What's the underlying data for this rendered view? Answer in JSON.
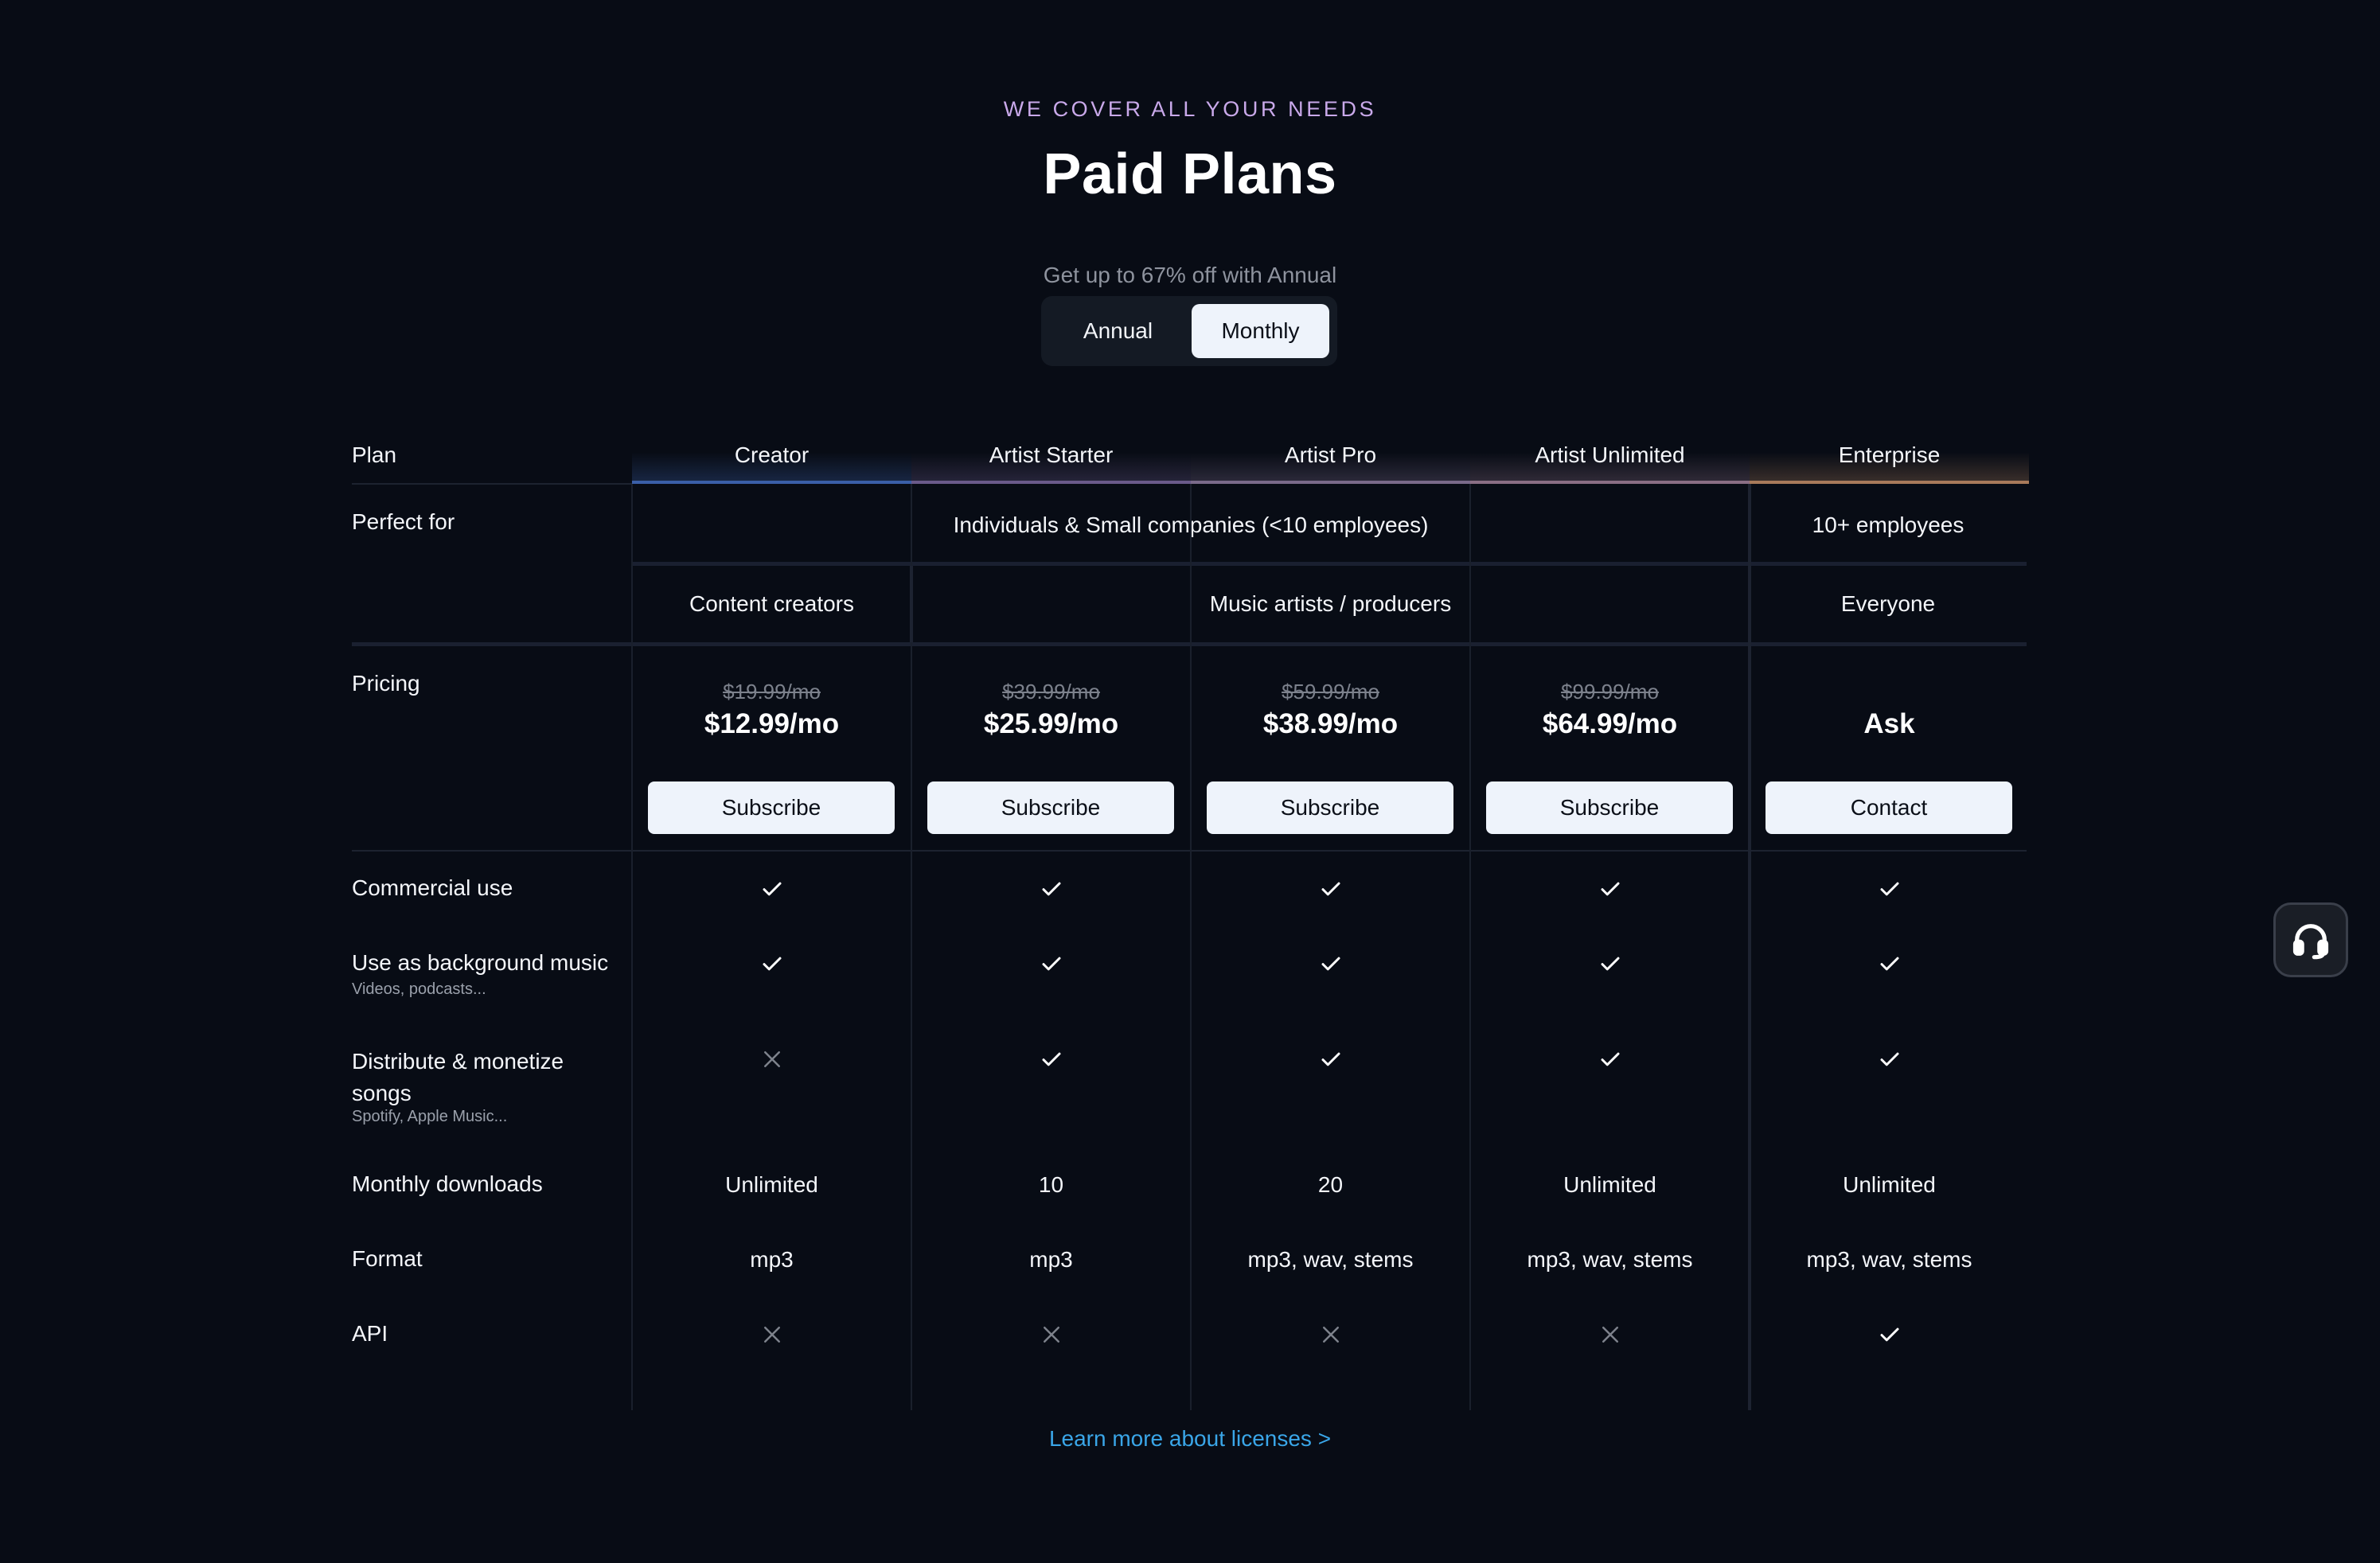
{
  "header": {
    "eyebrow": "WE COVER ALL YOUR NEEDS",
    "title": "Paid Plans",
    "discount_note": "Get up to 67% off with Annual"
  },
  "billing_toggle": {
    "options": [
      "Annual",
      "Monthly"
    ],
    "selected": "Monthly"
  },
  "table": {
    "row_labels": {
      "plan": "Plan",
      "perfect_for": "Perfect for",
      "pricing": "Pricing",
      "commercial_use": "Commercial use",
      "background_music": "Use as background music",
      "background_music_sub": "Videos, podcasts...",
      "distribute": "Distribute & monetize songs",
      "distribute_line1": "Distribute & monetize",
      "distribute_line2": "songs",
      "distribute_sub": "Spotify, Apple Music...",
      "monthly_downloads": "Monthly downloads",
      "format": "Format",
      "api": "API"
    },
    "audience_groups": {
      "row1": [
        {
          "text": "Individuals & Small companies (<10 employees)",
          "span": "Creator–Artist Unlimited"
        },
        {
          "text": "10+ employees",
          "span": "Enterprise"
        }
      ],
      "row2": [
        {
          "text": "Content creators",
          "span": "Creator"
        },
        {
          "text": "Music artists / producers",
          "span": "Artist Starter–Artist Unlimited"
        },
        {
          "text": "Everyone",
          "span": "Enterprise"
        }
      ]
    },
    "plans": [
      {
        "name": "Creator",
        "old_price": "$19.99/mo",
        "price": "$12.99/mo",
        "cta": "Subscribe",
        "commercial_use": true,
        "background_music": true,
        "distribute": false,
        "monthly_downloads": "Unlimited",
        "format": "mp3",
        "api": false
      },
      {
        "name": "Artist Starter",
        "old_price": "$39.99/mo",
        "price": "$25.99/mo",
        "cta": "Subscribe",
        "commercial_use": true,
        "background_music": true,
        "distribute": true,
        "monthly_downloads": "10",
        "format": "mp3",
        "api": false
      },
      {
        "name": "Artist Pro",
        "old_price": "$59.99/mo",
        "price": "$38.99/mo",
        "cta": "Subscribe",
        "commercial_use": true,
        "background_music": true,
        "distribute": true,
        "monthly_downloads": "20",
        "format": "mp3, wav, stems",
        "api": false
      },
      {
        "name": "Artist Unlimited",
        "old_price": "$99.99/mo",
        "price": "$64.99/mo",
        "cta": "Subscribe",
        "commercial_use": true,
        "background_music": true,
        "distribute": true,
        "monthly_downloads": "Unlimited",
        "format": "mp3, wav, stems",
        "api": false
      },
      {
        "name": "Enterprise",
        "old_price": "",
        "price": "Ask",
        "cta": "Contact",
        "commercial_use": true,
        "background_music": true,
        "distribute": true,
        "monthly_downloads": "Unlimited",
        "format": "mp3, wav, stems",
        "api": true
      }
    ],
    "accent_colors": [
      "#3a5fa8",
      "#6a5a8a",
      "#7a6a8a",
      "#8a6e84",
      "#a87a5a"
    ]
  },
  "footer": {
    "learn_more": "Learn more about licenses >"
  },
  "icons": {
    "check": "check-icon",
    "cross": "cross-icon",
    "support": "headset-icon"
  }
}
